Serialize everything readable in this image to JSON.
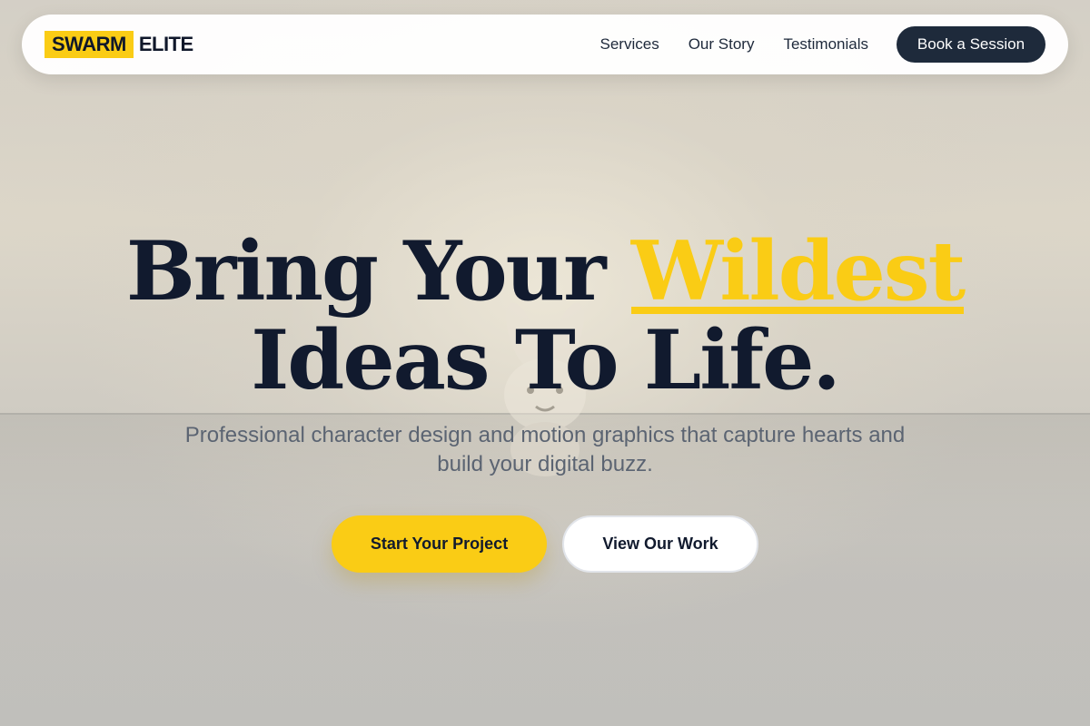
{
  "brand": {
    "mark": "SWARM",
    "word": "ELITE",
    "accent_color": "#facc15",
    "dark_color": "#1e2a3b"
  },
  "nav": {
    "links": [
      {
        "label": "Services"
      },
      {
        "label": "Our Story"
      },
      {
        "label": "Testimonials"
      }
    ],
    "cta_label": "Book a Session"
  },
  "hero": {
    "title_part1": "Bring Your",
    "title_accent": "Wildest",
    "title_line2": "Ideas To Life.",
    "subtitle": "Professional character design and motion graphics that capture hearts and build your digital buzz.",
    "primary_button": "Start Your Project",
    "secondary_button": "View Our Work"
  },
  "background": {
    "mascot_icon": "rabbit-figurine-icon"
  }
}
